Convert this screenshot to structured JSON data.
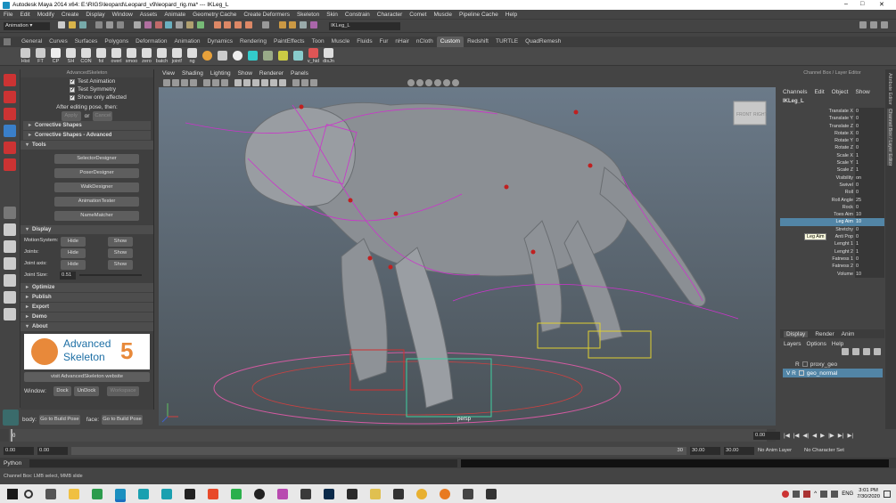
{
  "window": {
    "title": "Autodesk Maya 2014 x64: E:\\RIGS\\leopard\\Leopard_v9\\leopard_rig.ma*  ---  IKLeg_L",
    "controls": [
      "–",
      "□",
      "✕"
    ]
  },
  "menubar": [
    "File",
    "Edit",
    "Modify",
    "Create",
    "Display",
    "Window",
    "Assets",
    "Animate",
    "Geometry Cache",
    "Create Deformers",
    "Skeleton",
    "Skin",
    "Constrain",
    "Character",
    "Comet",
    "Muscle",
    "Pipeline Cache",
    "Help"
  ],
  "statusline": {
    "mode": "Animation",
    "selection_field": "IKLeg_L"
  },
  "shelf_tabs": [
    "General",
    "Curves",
    "Surfaces",
    "Polygons",
    "Deformation",
    "Animation",
    "Dynamics",
    "Rendering",
    "PaintEffects",
    "Toon",
    "Muscle",
    "Fluids",
    "Fur",
    "nHair",
    "nCloth",
    "Custom",
    "Redshift",
    "TURTLE",
    "QuadRemesh"
  ],
  "shelf_active_tab": "Custom",
  "shelf_buttons": [
    "Hist",
    "FT",
    "CP",
    "SH",
    "CON",
    "fol",
    "overl",
    "smoo",
    "zero",
    "batch",
    "joint!",
    "ng",
    "",
    "",
    "",
    "",
    "",
    "",
    "",
    "v_hid",
    "disJn"
  ],
  "advanced_skeleton": {
    "panel_title": "AdvancedSkeleton",
    "checkboxes": [
      "Test Animation",
      "Test Symmetry",
      "Show only affected"
    ],
    "after_editing": "After editing pose, then:",
    "apply": "Apply",
    "or": "or",
    "cancel": "Cancel",
    "corrective_shapes": "Corrective Shapes",
    "corrective_shapes_adv": "Corrective Shapes - Advanced",
    "tools": "Tools",
    "tool_buttons": [
      "SelectorDesigner",
      "PoserDesigner",
      "WalkDesigner",
      "AnimationTester",
      "NameMatcher"
    ],
    "display": "Display",
    "motion_system": "MotionSystem:",
    "joints": "Joints:",
    "joint_axis": "Joint axis:",
    "joint_size": "Joint Size:",
    "joint_size_value": "0.51",
    "hide": "Hide",
    "show": "Show",
    "collapsed": [
      "Optimize",
      "Publish",
      "Export",
      "Demo"
    ],
    "about": "About",
    "logo_line1": "Advanced",
    "logo_line2": "Skeleton",
    "logo_num": "5",
    "website": "visit AdvancedSkeleton website",
    "window_label": "Window:",
    "dock": "Dock",
    "undock": "UnDock",
    "workspace": "Workspace",
    "body_label": "body:",
    "go_build_pose": "Go to Build Pose",
    "face_label": "face:"
  },
  "viewport": {
    "menu": [
      "View",
      "Shading",
      "Lighting",
      "Show",
      "Renderer",
      "Panels"
    ],
    "camera_label": "persp",
    "viewcube_front": "FRONT",
    "viewcube_right": "RIGHT",
    "tooltip": "Leg Aim"
  },
  "channel_box": {
    "header": "Channel Box / Layer Editor",
    "menu": [
      "Channels",
      "Edit",
      "Object",
      "Show"
    ],
    "object": "IKLeg_L",
    "attributes": [
      {
        "name": "Translate X",
        "value": "0"
      },
      {
        "name": "Translate Y",
        "value": "0"
      },
      {
        "name": "Translate Z",
        "value": "0"
      },
      {
        "name": "Rotate X",
        "value": "0"
      },
      {
        "name": "Rotate Y",
        "value": "0"
      },
      {
        "name": "Rotate Z",
        "value": "0"
      },
      {
        "name": "Scale X",
        "value": "1"
      },
      {
        "name": "Scale Y",
        "value": "1"
      },
      {
        "name": "Scale Z",
        "value": "1"
      },
      {
        "name": "Visibility",
        "value": "on"
      },
      {
        "name": "Swivel",
        "value": "0"
      },
      {
        "name": "Roll",
        "value": "0"
      },
      {
        "name": "Roll Angle",
        "value": "25"
      },
      {
        "name": "Rock",
        "value": "0"
      },
      {
        "name": "Toes Aim",
        "value": "10"
      },
      {
        "name": "Leg Aim",
        "value": "10"
      },
      {
        "name": "Stretchy",
        "value": "0"
      },
      {
        "name": "Anti Pop",
        "value": "0"
      },
      {
        "name": "Lenght 1",
        "value": "1"
      },
      {
        "name": "Lenght 2",
        "value": "1"
      },
      {
        "name": "Fatness 1",
        "value": "0"
      },
      {
        "name": "Fatness 2",
        "value": "0"
      },
      {
        "name": "Volume",
        "value": "10"
      }
    ],
    "selected_attr": "Leg Aim",
    "layer_tabs": [
      "Display",
      "Render",
      "Anim"
    ],
    "layer_menu": [
      "Layers",
      "Options",
      "Help"
    ],
    "layers": [
      {
        "flags": "R",
        "name": "proxy_geo"
      },
      {
        "flags": "V R",
        "name": "geo_normal"
      }
    ]
  },
  "side_tabs": [
    "Attribute Editor",
    "Channel Box / Layer Editor"
  ],
  "time_slider": {
    "ticks": [
      "0",
      "",
      "",
      "",
      "",
      "",
      "",
      "",
      "",
      "",
      "",
      "",
      "",
      "",
      "",
      "",
      "",
      "",
      "",
      "",
      "",
      "",
      "",
      "",
      "",
      "",
      "",
      "",
      "",
      "",
      ""
    ],
    "current": "0.00"
  },
  "range_slider": {
    "start": "0.00",
    "start2": "0.00",
    "range_end_label": "30",
    "end": "30.00",
    "end2": "30.00",
    "anim_layer": "No Anim Layer",
    "char_set": "No Character Set"
  },
  "command_line": {
    "label": "Python"
  },
  "help_line": "Channel Box: LMB select, MMB slide",
  "taskbar": {
    "time": "3:01 PM",
    "date": "7/30/2020",
    "lang": "ENG"
  }
}
